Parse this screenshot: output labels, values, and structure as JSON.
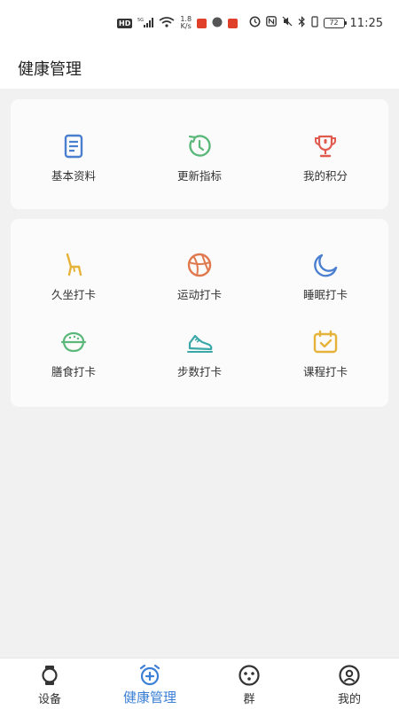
{
  "status_bar": {
    "hd": "HD",
    "network": "5G",
    "wifi_sub": "6",
    "speed_value": "1.8",
    "speed_unit": "K/s",
    "battery": "72",
    "time": "11:25"
  },
  "header": {
    "title": "健康管理"
  },
  "profile_card": {
    "items": [
      {
        "label": "基本资料",
        "icon": "document-icon",
        "color": "#4a7fd0"
      },
      {
        "label": "更新指标",
        "icon": "refresh-clock-icon",
        "color": "#5bb87a"
      },
      {
        "label": "我的积分",
        "icon": "trophy-icon",
        "color": "#e05a4e"
      }
    ]
  },
  "checkin_card": {
    "items": [
      {
        "label": "久坐打卡",
        "icon": "chair-icon",
        "color": "#e6b33a"
      },
      {
        "label": "运动打卡",
        "icon": "basketball-icon",
        "color": "#e07a4e"
      },
      {
        "label": "睡眠打卡",
        "icon": "moon-icon",
        "color": "#4a7fd0"
      },
      {
        "label": "膳食打卡",
        "icon": "bowl-icon",
        "color": "#5bb87a"
      },
      {
        "label": "步数打卡",
        "icon": "sneaker-icon",
        "color": "#3aa8a8"
      },
      {
        "label": "课程打卡",
        "icon": "calendar-check-icon",
        "color": "#e6b33a"
      }
    ]
  },
  "bottom_nav": {
    "items": [
      {
        "label": "设备",
        "icon": "watch-icon",
        "active": false
      },
      {
        "label": "健康管理",
        "icon": "health-alarm-icon",
        "active": true
      },
      {
        "label": "群",
        "icon": "group-icon",
        "active": false
      },
      {
        "label": "我的",
        "icon": "profile-icon",
        "active": false
      }
    ],
    "active_color": "#3b7fd6"
  }
}
